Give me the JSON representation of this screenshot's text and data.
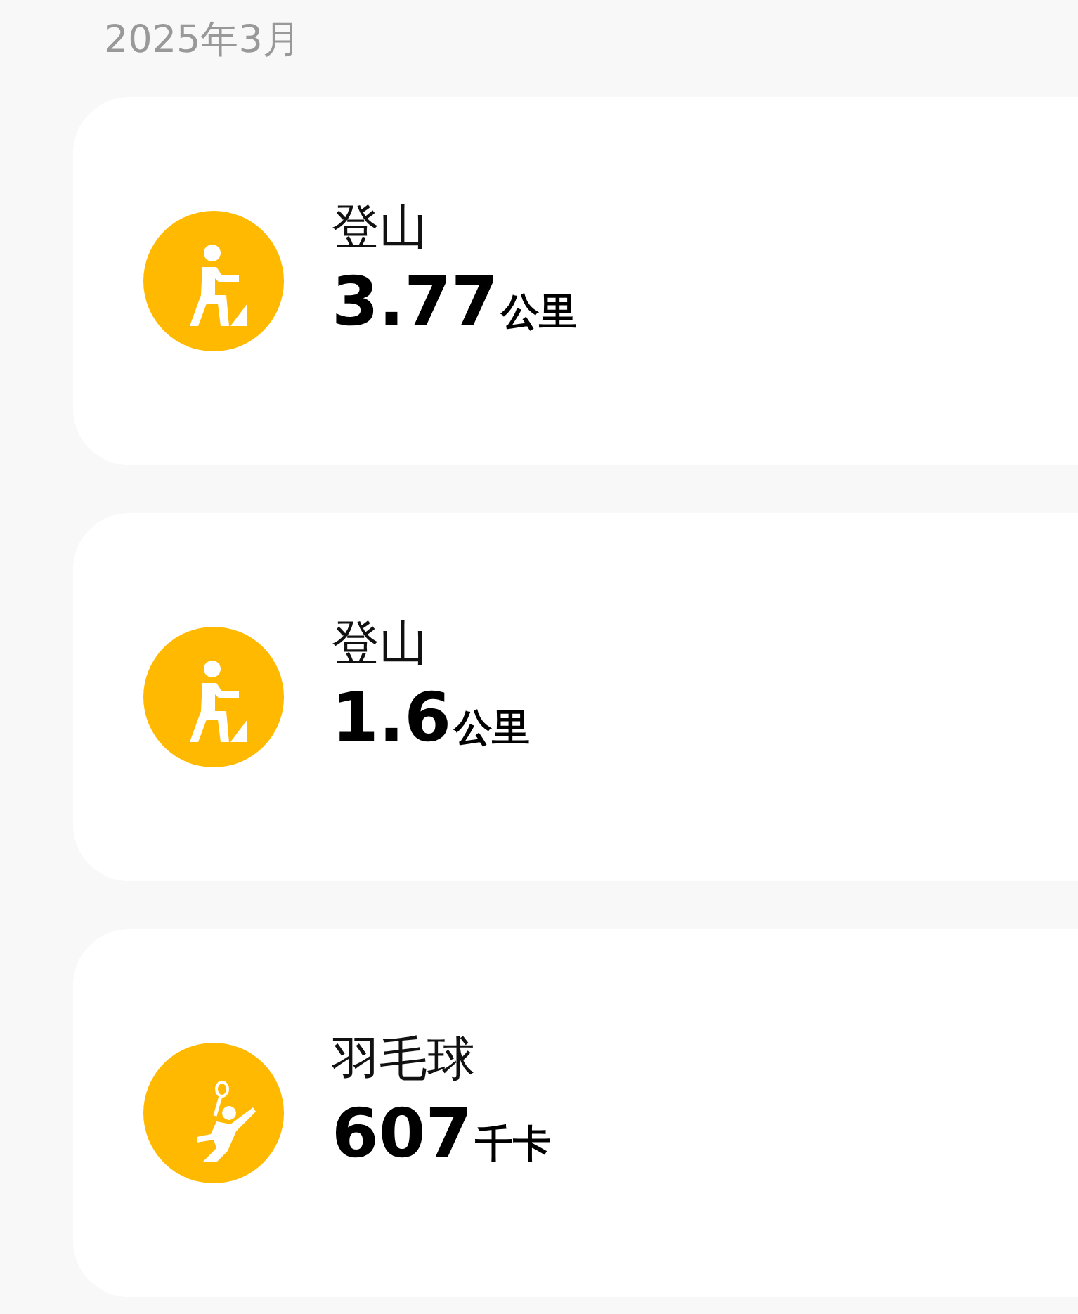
{
  "month": "2025年3月",
  "records": [
    {
      "kind": "hiking",
      "title": "登山",
      "value": "3.77",
      "unit": "公里"
    },
    {
      "kind": "hiking",
      "title": "登山",
      "value": "1.6",
      "unit": "公里"
    },
    {
      "kind": "badminton",
      "title": "羽毛球",
      "value": "607",
      "unit": "千卡"
    }
  ]
}
